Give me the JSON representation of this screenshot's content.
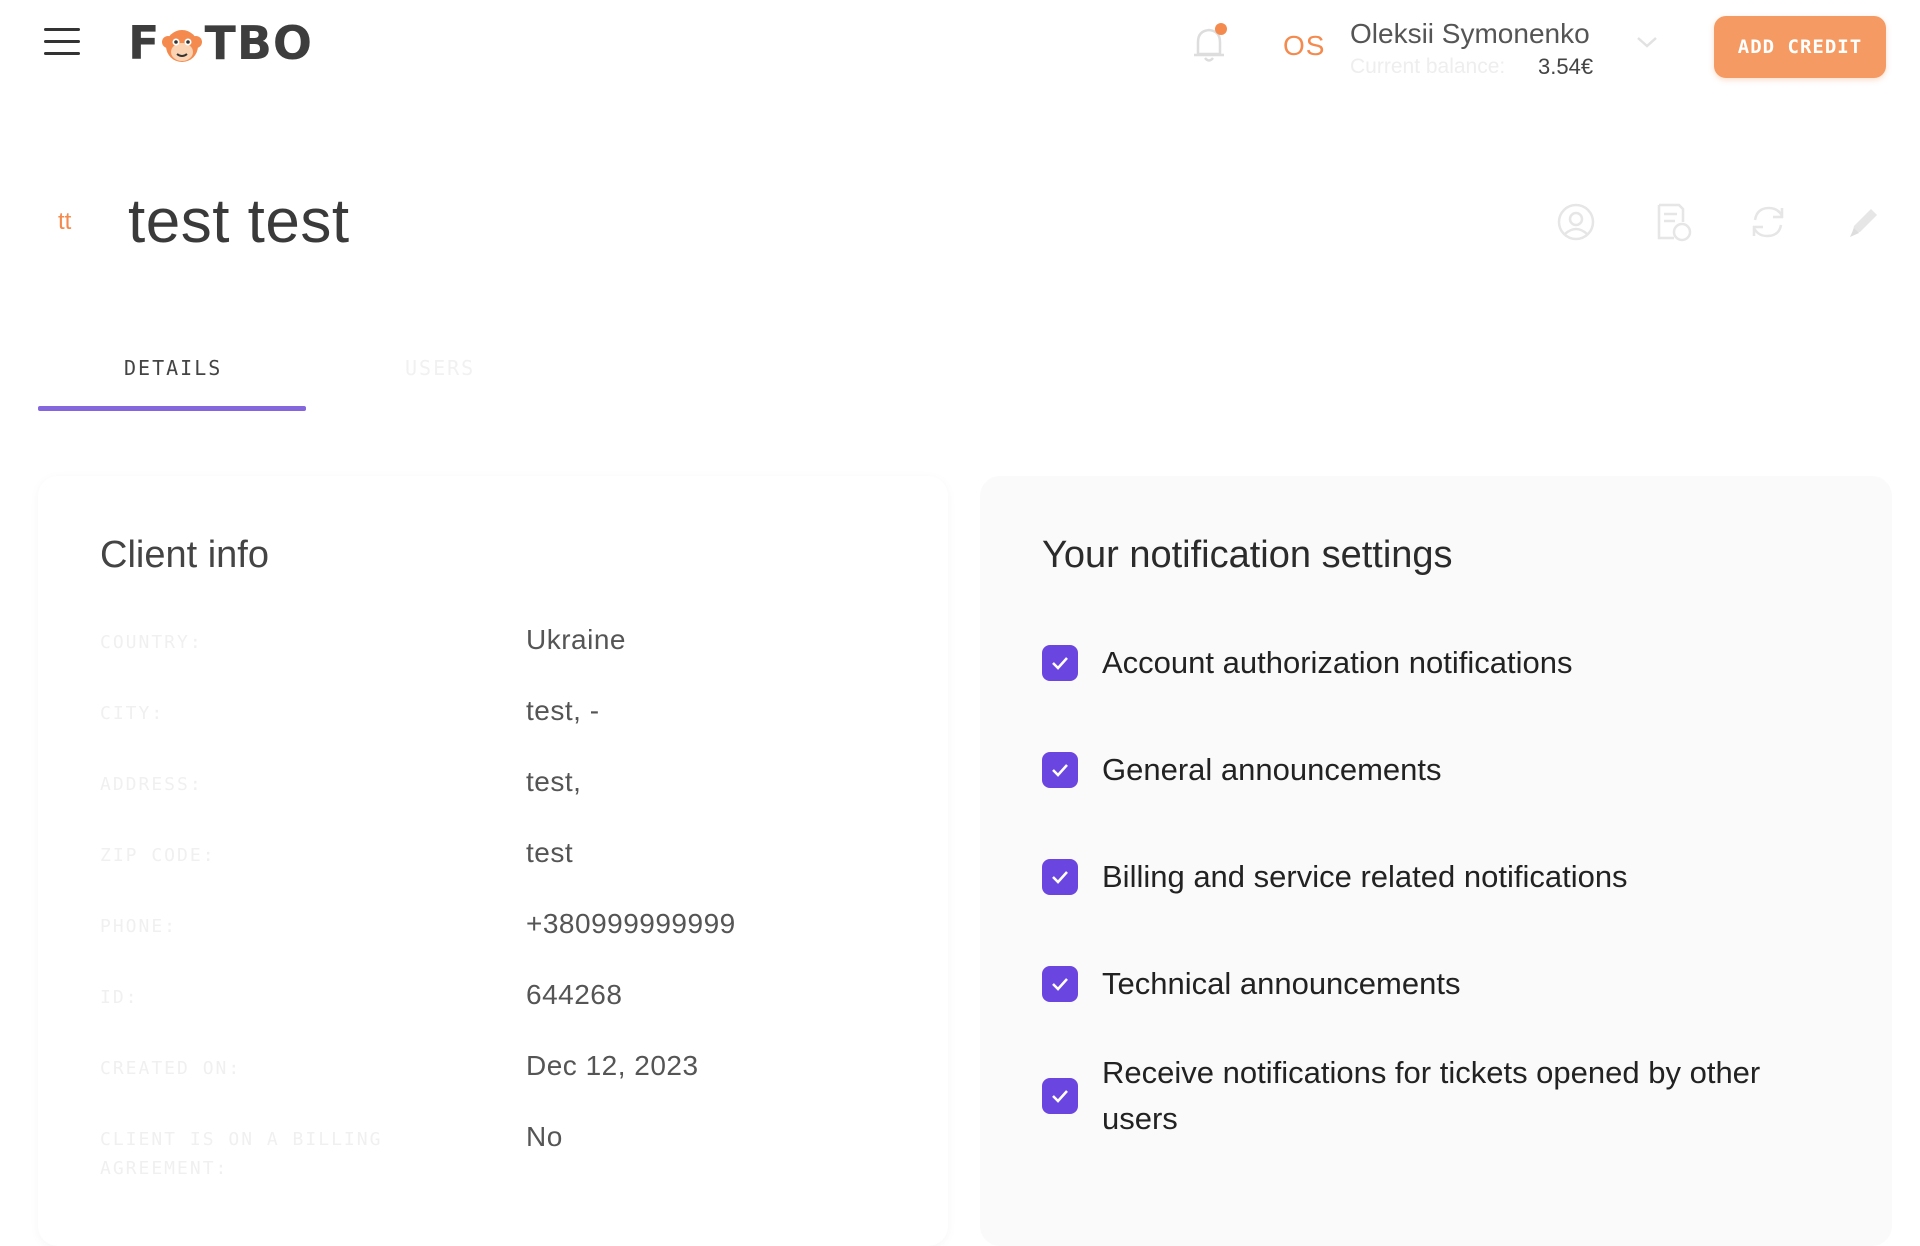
{
  "header": {
    "brand_logo": "F🐵TBO",
    "brand": {
      "prefix": "F",
      "suffix": "TBO"
    },
    "initials": "OS",
    "user_name": "Oleksii Symonenko",
    "balance_label": "Current balance:",
    "balance_value": "3.54€",
    "add_credit_label": "ADD CREDIT",
    "accent_color": "#f58a4e",
    "notification_dot_color": "#f58a4e"
  },
  "client": {
    "initials": "tt",
    "title": "test test",
    "actions": [
      "user-circle-icon",
      "invoice-icon",
      "refresh-icon",
      "pencil-icon"
    ]
  },
  "tabs": [
    {
      "label": "DETAILS",
      "active": true
    },
    {
      "label": "USERS",
      "active": false
    }
  ],
  "client_info": {
    "title": "Client info",
    "rows": [
      {
        "label": "COUNTRY:",
        "value": "Ukraine"
      },
      {
        "label": "CITY:",
        "value": "test, -"
      },
      {
        "label": "ADDRESS:",
        "value": "test,"
      },
      {
        "label": "ZIP CODE:",
        "value": "test"
      },
      {
        "label": "PHONE:",
        "value": "+380999999999"
      },
      {
        "label": "ID:",
        "value": "644268"
      },
      {
        "label": "CREATED ON:",
        "value": "Dec 12, 2023"
      },
      {
        "label": "CLIENT IS ON A BILLING AGREEMENT:",
        "value": "No"
      }
    ]
  },
  "notifications": {
    "title": "Your notification settings",
    "checkbox_color": "#6b45e0",
    "items": [
      {
        "label": "Account authorization notifications",
        "checked": true
      },
      {
        "label": "General announcements",
        "checked": true
      },
      {
        "label": "Billing and service related notifications",
        "checked": true
      },
      {
        "label": "Technical announcements",
        "checked": true
      },
      {
        "label": "Receive notifications for tickets opened by other users",
        "checked": true
      }
    ]
  }
}
